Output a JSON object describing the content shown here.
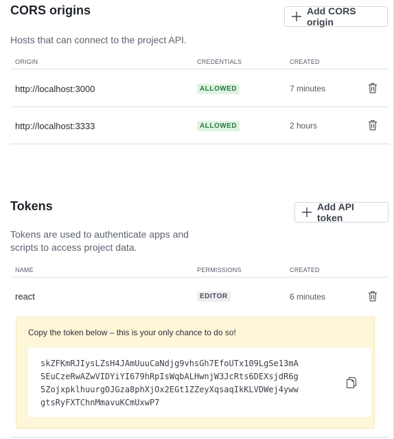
{
  "cors": {
    "title": "CORS origins",
    "add_button": "Add CORS origin",
    "description": "Hosts that can connect to the project API.",
    "columns": {
      "origin": "ORIGIN",
      "credentials": "CREDENTIALS",
      "created": "CREATED"
    },
    "rows": [
      {
        "origin": "http://localhost:3000",
        "credentials": "ALLOWED",
        "created": "7 minutes"
      },
      {
        "origin": "http://localhost:3333",
        "credentials": "ALLOWED",
        "created": "2 hours"
      }
    ]
  },
  "tokens": {
    "title": "Tokens",
    "add_button": "Add API token",
    "description_line1": "Tokens are used to authenticate apps and",
    "description_line2": "scripts to access project data.",
    "columns": {
      "name": "NAME",
      "permissions": "PERMISSIONS",
      "created": "CREATED"
    },
    "rows": [
      {
        "name": "react",
        "permissions": "EDITOR",
        "created": "6 minutes"
      }
    ],
    "notice": {
      "message": "Copy the token below – this is your only chance to do so!",
      "token_line1": "skZFKmRJIysLZsH4JAmUuuCaNdjg9vhsGh7EfoUTx109LgSe13mA",
      "token_line2": "SEuCzeRwAZwVIDYiYI679hRpIsWqbALHwnjW3JcRts6DEXsjdR6g",
      "token_line3": "5ZojxpklhuurgOJGza8phXjOx2EGt1ZZeyXqsaqIkKLVDWej4yww",
      "token_line4": "gtsRyFXTChnMmavuKCmUxwP7"
    }
  },
  "icons": {
    "add": "plus-icon",
    "delete": "trash-icon",
    "copy": "copy-icon"
  },
  "colors": {
    "allowed_badge_bg": "#dff3e3",
    "allowed_badge_text": "#2d7a3e",
    "notice_bg": "#fdf6d9"
  }
}
